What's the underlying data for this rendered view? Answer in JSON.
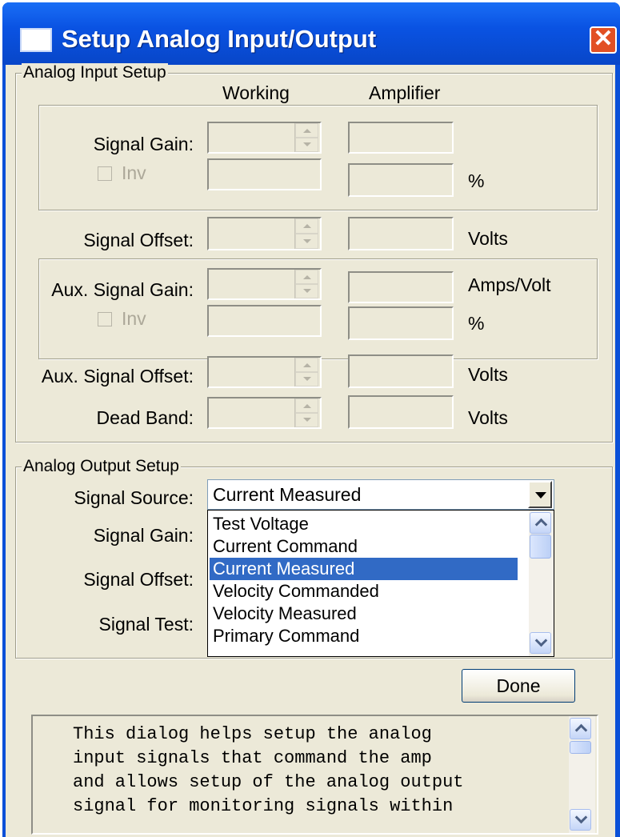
{
  "window": {
    "title": "Setup Analog Input/Output",
    "close_icon": "close-icon",
    "app_icon": "window-icon"
  },
  "input_setup": {
    "legend": "Analog Input Setup",
    "col_working": "Working",
    "col_amplifier": "Amplifier",
    "signal_gain_label": "Signal Gain:",
    "inv_label": "Inv",
    "percent_unit": "%",
    "signal_offset_label": "Signal Offset:",
    "volts_unit": "Volts",
    "aux_gain_label": "Aux. Signal Gain:",
    "amps_per_volt_unit": "Amps/Volt",
    "aux_offset_label": "Aux. Signal Offset:",
    "dead_band_label": "Dead Band:"
  },
  "output_setup": {
    "legend": "Analog Output Setup",
    "signal_source_label": "Signal Source:",
    "signal_source_value": "Current Measured",
    "signal_gain_label": "Signal Gain:",
    "signal_offset_label": "Signal Offset:",
    "signal_test_label": "Signal Test:",
    "options": [
      "Test Voltage",
      "Current Command",
      "Current Measured",
      "Velocity Commanded",
      "Velocity Measured",
      "Primary Command"
    ],
    "selected_index": 2
  },
  "buttons": {
    "done": "Done"
  },
  "description": {
    "lines": [
      "This dialog helps setup the analog",
      "input signals that command the amp",
      "and allows setup of the analog output",
      "signal for monitoring signals within"
    ]
  },
  "colors": {
    "titlebar": "#0a53e3",
    "dialog_bg": "#ece9d8",
    "selection": "#316ac5",
    "close_button": "#e25024"
  }
}
